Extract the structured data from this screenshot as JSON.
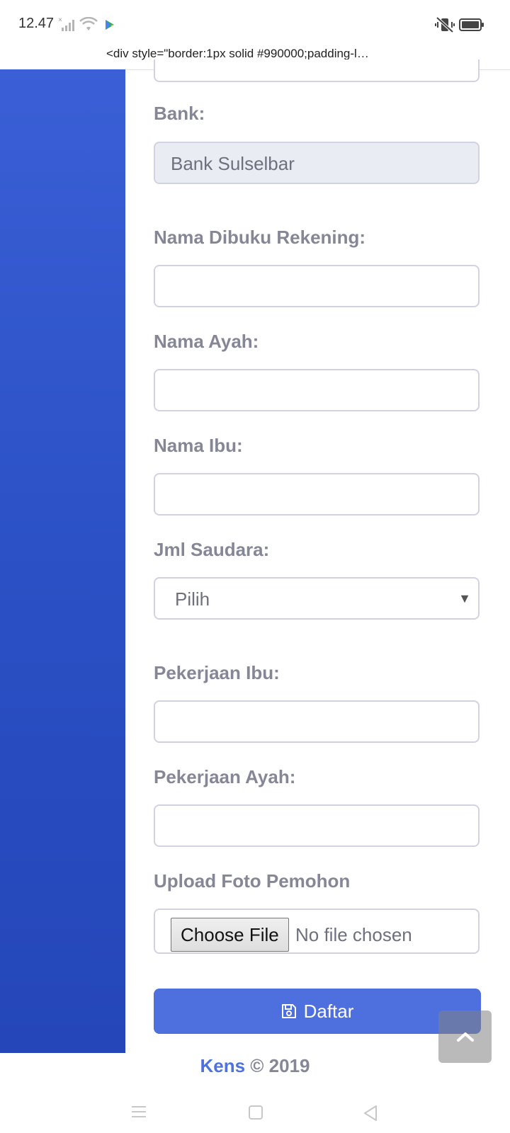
{
  "status_bar": {
    "time": "12.47",
    "signal_x": "×"
  },
  "browser": {
    "url": "<div style=\"border:1px solid #990000;padding-l…"
  },
  "form": {
    "bank": {
      "label": "Bank:",
      "value": "Bank Sulselbar"
    },
    "nama_rekening": {
      "label": "Nama Dibuku Rekening:",
      "value": ""
    },
    "nama_ayah": {
      "label": "Nama Ayah:",
      "value": ""
    },
    "nama_ibu": {
      "label": "Nama Ibu:",
      "value": ""
    },
    "jml_saudara": {
      "label": "Jml Saudara:",
      "value": "Pilih"
    },
    "pekerjaan_ibu": {
      "label": "Pekerjaan Ibu:",
      "value": ""
    },
    "pekerjaan_ayah": {
      "label": "Pekerjaan Ayah:",
      "value": ""
    },
    "upload_foto": {
      "label": "Upload Foto Pemohon",
      "button": "Choose File",
      "status": "No file chosen"
    }
  },
  "submit": {
    "label": "Daftar"
  },
  "footer": {
    "brand": "Kens",
    "copyright": "© 2019"
  },
  "colors": {
    "sidebar": "#2a4fc4",
    "primary_button": "#4e6fde",
    "label": "#858796",
    "brand": "#4e73df"
  },
  "icons": {
    "save": "save-icon",
    "scroll_top": "chevron-up-icon"
  }
}
